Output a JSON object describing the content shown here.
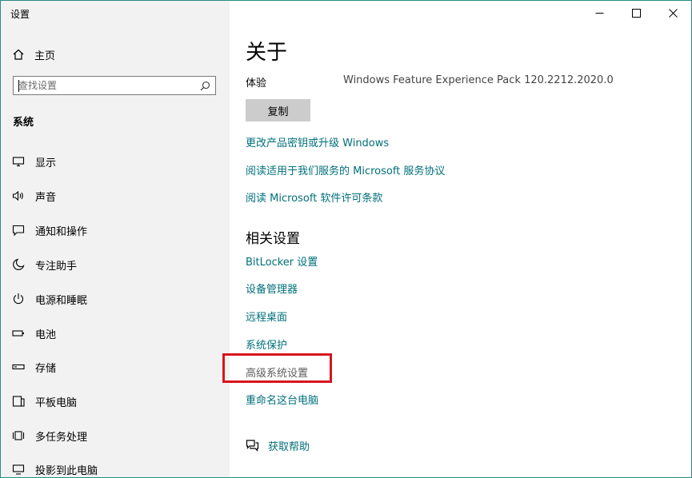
{
  "window": {
    "title": "设置"
  },
  "sidebar": {
    "home_label": "主页",
    "search_placeholder": "查找设置",
    "section_title": "系统",
    "items": [
      {
        "label": "显示",
        "icon": "monitor-icon"
      },
      {
        "label": "声音",
        "icon": "speaker-icon"
      },
      {
        "label": "通知和操作",
        "icon": "notification-icon"
      },
      {
        "label": "专注助手",
        "icon": "moon-icon"
      },
      {
        "label": "电源和睡眠",
        "icon": "power-icon"
      },
      {
        "label": "电池",
        "icon": "battery-icon"
      },
      {
        "label": "存储",
        "icon": "storage-icon"
      },
      {
        "label": "平板电脑",
        "icon": "tablet-icon"
      },
      {
        "label": "多任务处理",
        "icon": "multitask-icon"
      },
      {
        "label": "投影到此电脑",
        "icon": "project-icon"
      }
    ]
  },
  "main": {
    "title": "关于",
    "experience_label": "体验",
    "experience_value": "Windows Feature Experience Pack 120.2212.2020.0",
    "copy_label": "复制",
    "links": [
      "更改产品密钥或升级 Windows",
      "阅读适用于我们服务的 Microsoft 服务协议",
      "阅读 Microsoft 软件许可条款"
    ],
    "related_title": "相关设置",
    "related_links": [
      "BitLocker 设置",
      "设备管理器",
      "远程桌面",
      "系统保护",
      "高级系统设置",
      "重命名这台电脑"
    ],
    "help_label": "获取帮助"
  },
  "colors": {
    "link": "#00707a",
    "highlight": "#d8141c",
    "sidebar_bg": "#f2f2f2",
    "window_border": "#2b8a7e"
  }
}
